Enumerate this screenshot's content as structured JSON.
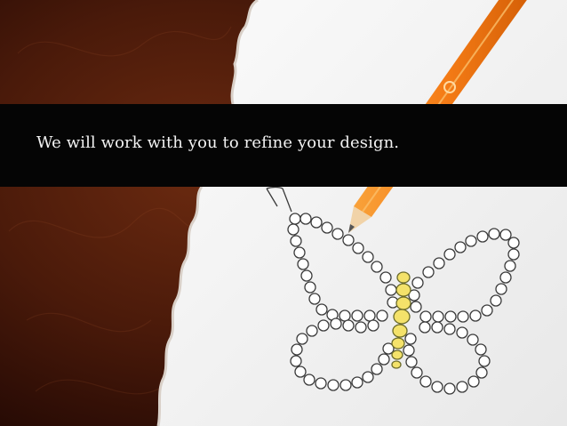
{
  "slide": {
    "caption": "We will work with you to refine your design."
  },
  "colors": {
    "background_brown": "#4a1a0a",
    "paper": "#f4f4f4",
    "band": "#050505",
    "pencil_orange": "#f57c16",
    "bead_yellow": "#f4e26a",
    "sketch_line": "#3a3a3a"
  },
  "icons": {
    "pencil": "pencil-icon",
    "butterfly": "butterfly-pendant-sketch"
  }
}
